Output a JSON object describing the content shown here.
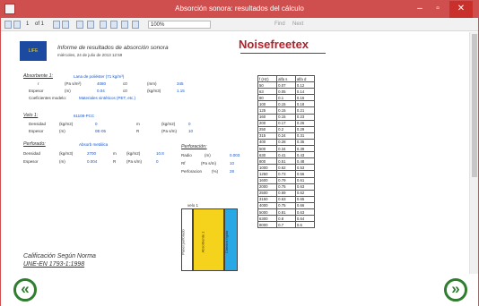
{
  "window": {
    "title": "Absorción sonora: resultados del cálculo",
    "minimize": "–",
    "maximize": "▫",
    "close": "✕"
  },
  "toolbar": {
    "page_current": "1",
    "page_of": "of 1",
    "zoom": "100%",
    "find": "Find",
    "next": "Next"
  },
  "header": {
    "title": "Informe de resultados de absorción sonora",
    "date": "miércoles, 24 de julio de 2013 12:59",
    "logo_eu": "LIFE",
    "brand": "Noisefreetex"
  },
  "absorbente": {
    "heading": "Absorbente 1:",
    "name": "Lana de poliéster (71 kg/m³)",
    "row1": {
      "l1": "r",
      "l2": "(Pa s/m²)",
      "v1": "4080",
      "l3": "c0",
      "v2": "",
      "l4": "(mm)",
      "v3": "345"
    },
    "row2": {
      "l1": "Espesor",
      "l2": "(m)",
      "v1": "0.04",
      "l3": "c0",
      "v2": "",
      "l4": "(kg/m3)",
      "v3": "1.15"
    },
    "row3": {
      "l1": "Coeficientes modelo:",
      "v1": "Materiales sintéticos (PET, etc.)"
    }
  },
  "velo": {
    "heading": "Velo 1:",
    "name": "61108-PCC",
    "row1": {
      "l1": "Densidad",
      "l2": "(kg/m2)",
      "v1": "0",
      "l3": "m",
      "l4": "(kg/m2)",
      "v2": "0"
    },
    "row2": {
      "l1": "Espesor",
      "l2": "(m)",
      "v1": "0E-05",
      "l3": "R",
      "l4": "(Pa s/m)",
      "v2": "10"
    }
  },
  "perforado": {
    "heading": "Perforado:",
    "name": "Absorb metálica",
    "row1": {
      "l1": "Densidad",
      "l2": "(kg/m3)",
      "v1": "2700",
      "l3": "m",
      "l4": "(kg/m2)",
      "v2": "10.8"
    },
    "row2": {
      "l1": "Espesor",
      "l2": "(m)",
      "v1": "0.004",
      "l3": "R",
      "l4": "(Pa s/m)",
      "v2": "0"
    }
  },
  "perforacion": {
    "heading": "Perforación:",
    "row1": {
      "l1": "Radio",
      "l2": "(m)",
      "v1": "0.003"
    },
    "row2": {
      "l1": "Rf",
      "l2": "(Pa s/m)",
      "v1": "10"
    },
    "row3": {
      "l1": "Perforacion",
      "l2": "(%)",
      "v1": "28"
    }
  },
  "table": {
    "headers": [
      "f (Hz)",
      "alfa s",
      "alfa d"
    ],
    "rows": [
      [
        "50",
        "0.07",
        "0.12"
      ],
      [
        "63",
        "0.05",
        "0.14"
      ],
      [
        "80",
        "0.1",
        "0.16"
      ],
      [
        "100",
        "0.15",
        "0.18"
      ],
      [
        "125",
        "0.15",
        "0.21"
      ],
      [
        "160",
        "0.15",
        "0.23"
      ],
      [
        "200",
        "0.17",
        "0.26"
      ],
      [
        "250",
        "0.2",
        "0.29"
      ],
      [
        "315",
        "0.24",
        "0.31"
      ],
      [
        "400",
        "0.28",
        "0.35"
      ],
      [
        "500",
        "0.34",
        "0.39"
      ],
      [
        "630",
        "0.41",
        "0.43"
      ],
      [
        "800",
        "0.51",
        "0.48"
      ],
      [
        "1000",
        "0.62",
        "0.53"
      ],
      [
        "1250",
        "0.73",
        "0.56"
      ],
      [
        "1600",
        "0.79",
        "0.61"
      ],
      [
        "2000",
        "0.75",
        "0.63"
      ],
      [
        "2500",
        "0.69",
        "0.62"
      ],
      [
        "3150",
        "0.63",
        "0.65"
      ],
      [
        "4000",
        "0.75",
        "0.66"
      ],
      [
        "5000",
        "0.81",
        "0.63"
      ],
      [
        "6300",
        "0.8",
        "0.64"
      ],
      [
        "8000",
        "0.7",
        "0.6"
      ]
    ]
  },
  "diagram": {
    "velo_label": "velo 1",
    "perf_label": "Panel perforado",
    "abs_label": "Absorbente 1",
    "camera_label": "Cámara rígida"
  },
  "footer": {
    "line1": "Calificación Según Norma",
    "line2": "UNE-EN 1793-1:1998"
  },
  "nav": {
    "prev": "«",
    "next": "»"
  },
  "colors": {
    "titlebar": "#cf4f4f",
    "absorbent": "#f5d21c",
    "camera": "#28a9e6",
    "nav": "#2f7d2f",
    "values": "#1a55c8"
  }
}
